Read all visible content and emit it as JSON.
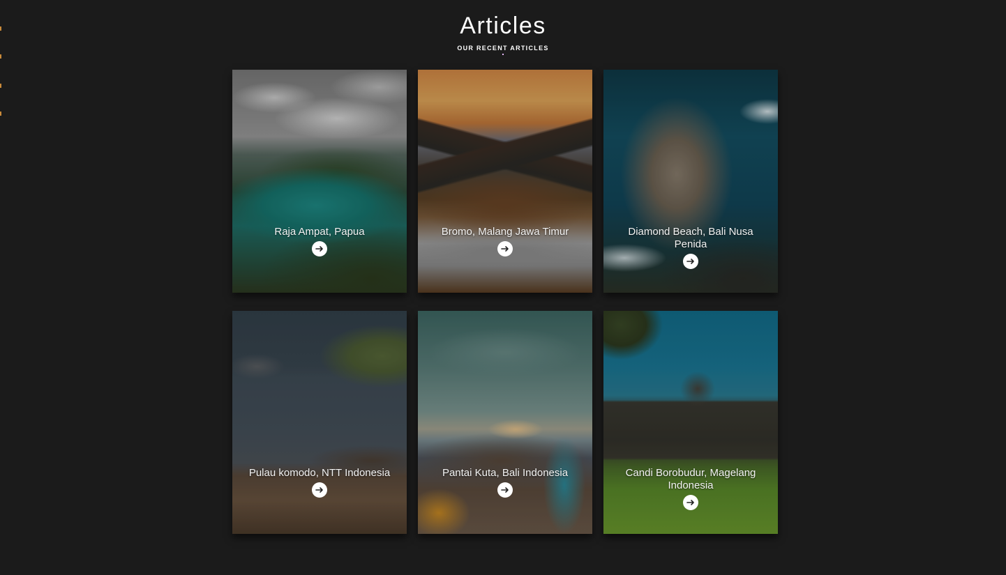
{
  "header": {
    "title": "Articles",
    "subtitle": "OUR RECENT ARTICLES"
  },
  "articles": [
    {
      "title": "Raja Ampat, Papua",
      "scene": "raja"
    },
    {
      "title": "Bromo, Malang Jawa Timur",
      "scene": "bromo"
    },
    {
      "title": "Diamond Beach, Bali Nusa Penida",
      "scene": "diamond"
    },
    {
      "title": "Pulau komodo, NTT Indonesia",
      "scene": "komodo"
    },
    {
      "title": "Pantai Kuta, Bali Indonesia",
      "scene": "kuta"
    },
    {
      "title": "Candi Borobudur, Magelang Indonesia",
      "scene": "borobudur"
    }
  ],
  "icons": {
    "card_button": "arrow-right-icon"
  },
  "colors": {
    "background": "#1b1b1b",
    "title": "#ffffff",
    "button": "#ffffff"
  }
}
